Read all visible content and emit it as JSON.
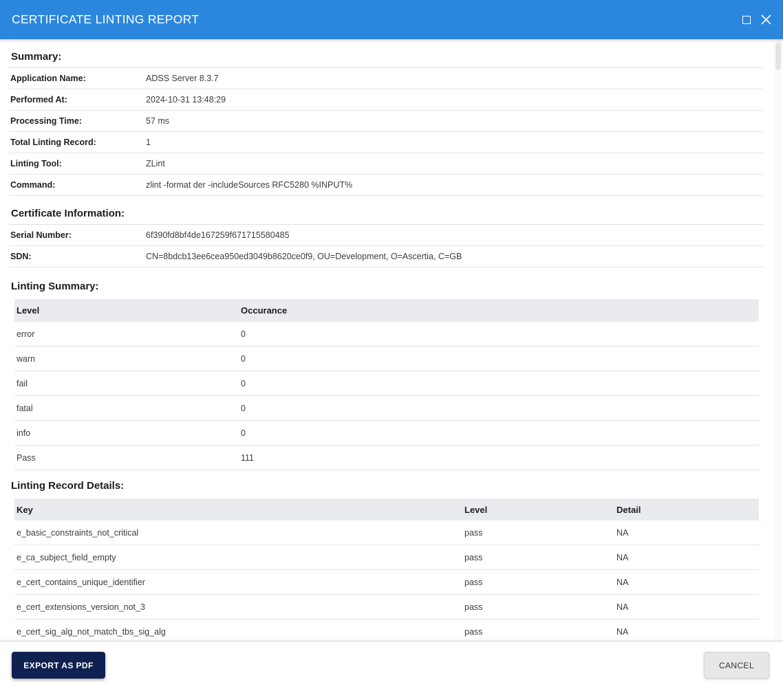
{
  "dialog": {
    "title": "CERTIFICATE LINTING REPORT",
    "accent_color": "#2b87de"
  },
  "summary": {
    "heading": "Summary:",
    "rows": [
      {
        "label": "Application Name:",
        "value": "ADSS Server 8.3.7"
      },
      {
        "label": "Performed At:",
        "value": "2024-10-31 13:48:29"
      },
      {
        "label": "Processing Time:",
        "value": "57 ms"
      },
      {
        "label": "Total Linting Record:",
        "value": "1"
      },
      {
        "label": "Linting Tool:",
        "value": "ZLint"
      },
      {
        "label": "Command:",
        "value": "zlint -format der -includeSources RFC5280 %INPUT%"
      }
    ]
  },
  "certificate_information": {
    "heading": "Certificate Information:",
    "rows": [
      {
        "label": "Serial Number:",
        "value": "6f390fd8bf4de167259f671715580485"
      },
      {
        "label": "SDN:",
        "value": "CN=8bdcb13ee6cea950ed3049b8620ce0f9, OU=Development, O=Ascertia, C=GB"
      }
    ]
  },
  "linting_summary": {
    "heading": "Linting Summary:",
    "columns": {
      "level": "Level",
      "occurance": "Occurance"
    },
    "rows": [
      {
        "level": "error",
        "occurance": "0"
      },
      {
        "level": "warn",
        "occurance": "0"
      },
      {
        "level": "fail",
        "occurance": "0"
      },
      {
        "level": "fatal",
        "occurance": "0"
      },
      {
        "level": "info",
        "occurance": "0"
      },
      {
        "level": "Pass",
        "occurance": "111"
      }
    ]
  },
  "linting_record_details": {
    "heading": "Linting Record Details:",
    "columns": {
      "key": "Key",
      "level": "Level",
      "detail": "Detail"
    },
    "rows": [
      {
        "key": "e_basic_constraints_not_critical",
        "level": "pass",
        "detail": "NA"
      },
      {
        "key": "e_ca_subject_field_empty",
        "level": "pass",
        "detail": "NA"
      },
      {
        "key": "e_cert_contains_unique_identifier",
        "level": "pass",
        "detail": "NA"
      },
      {
        "key": "e_cert_extensions_version_not_3",
        "level": "pass",
        "detail": "NA"
      },
      {
        "key": "e_cert_sig_alg_not_match_tbs_sig_alg",
        "level": "pass",
        "detail": "NA"
      }
    ]
  },
  "footer": {
    "export_label": "EXPORT AS PDF",
    "cancel_label": "CANCEL",
    "export_button_color": "#0f2150",
    "cancel_button_color": "#e7e7e7"
  }
}
